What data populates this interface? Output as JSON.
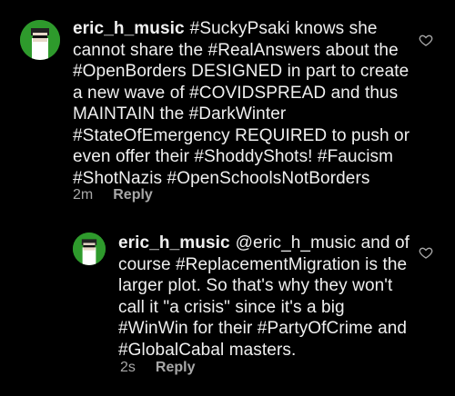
{
  "comments": [
    {
      "username": "eric_h_music",
      "body": "#SuckyPsaki knows she cannot share the #RealAnswers about the #OpenBorders DESIGNED in part to create a new wave of #COVIDSPREAD and thus MAINTAIN the #DarkWinter #StateOfEmergency REQUIRED to push or even offer their #ShoddyShots! #Faucism #ShotNazis #OpenSchoolsNotBorders",
      "time": "2m",
      "reply_label": "Reply"
    },
    {
      "username": "eric_h_music",
      "body": "@eric_h_music and of course #ReplacementMigration is the larger plot. So that's why they won't call it \"a crisis\" since it's a big #WinWin for their #PartyOfCrime and #GlobalCabal masters.",
      "time": "2s",
      "reply_label": "Reply"
    }
  ],
  "colors": {
    "background": "#000000",
    "text": "#f0f0f0",
    "muted": "#a8a8a8",
    "avatar_bg": "#2e9a2c"
  },
  "icons": [
    "avatar",
    "heart-icon"
  ]
}
